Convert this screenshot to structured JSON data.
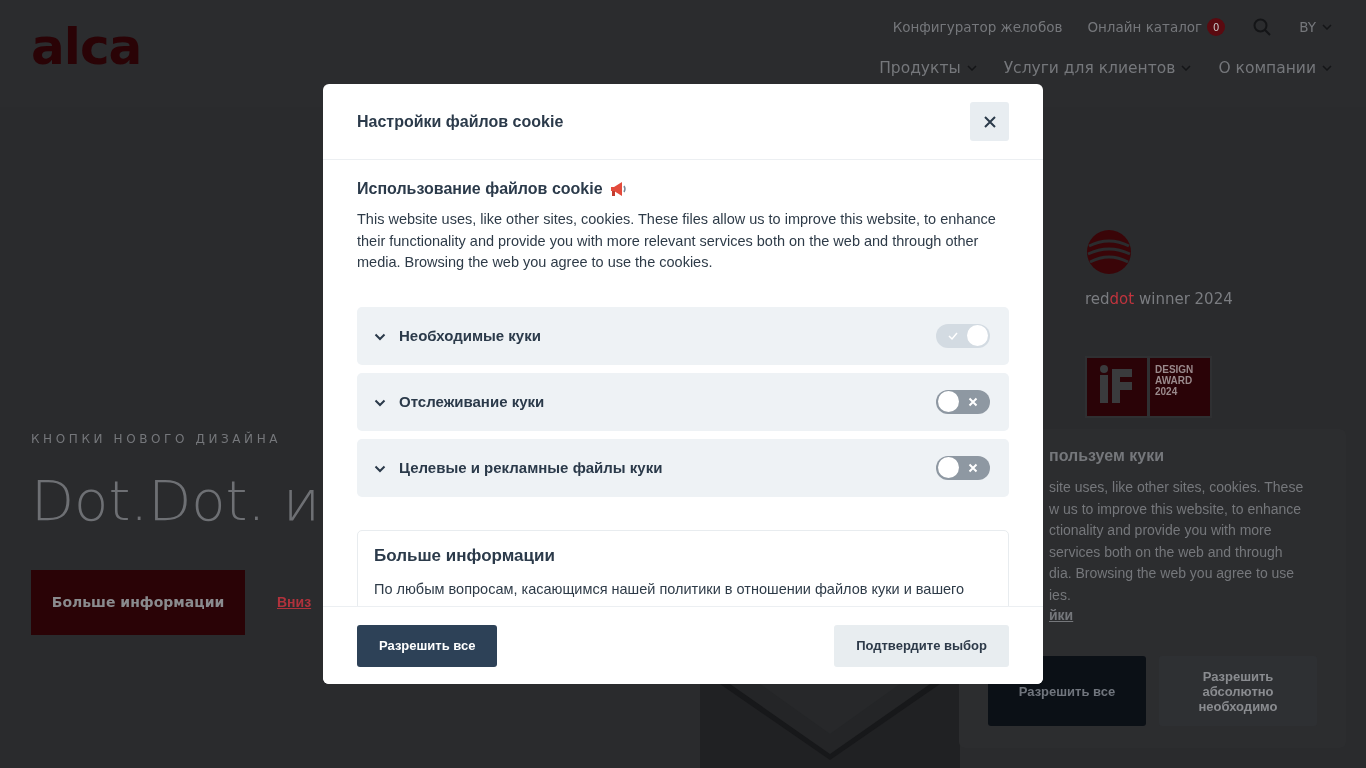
{
  "header": {
    "logo": "alca",
    "top_links": [
      {
        "label": "Конфигуратор желобов"
      },
      {
        "label": "Онлайн каталог",
        "badge": "0"
      }
    ],
    "language": "BY",
    "nav": [
      "Продукты",
      "Услуги для клиентов",
      "О компании"
    ]
  },
  "hero": {
    "eyebrow": "КНОПКИ НОВОГО ДИЗАЙНА",
    "title": "Dot.Dot. и",
    "button": "Больше информации",
    "link": "Вниз"
  },
  "awards": {
    "reddot": {
      "part_a": "red",
      "part_b": "dot",
      "caption": "winner 2024"
    },
    "if_award": [
      "DESIGN",
      "AWARD",
      "2024"
    ]
  },
  "cookie_banner": {
    "title": "пользуем куки",
    "lines": [
      "site uses, like other sites, cookies. These",
      "w us to improve this website, to enhance",
      "ctionality and provide you with more",
      "services both on the web and through",
      "dia. Browsing the web you agree to use",
      "ies."
    ],
    "link": "йки",
    "buttons": [
      {
        "label": "Разрешить все",
        "kind": "primary"
      },
      {
        "label": "Разрешить абсолютно необходимо",
        "kind": "secondary"
      }
    ]
  },
  "modal": {
    "title": "Настройки файлов cookie",
    "intro_title": "Использование файлов cookie",
    "intro_text": "This website uses, like other sites, cookies. These files allow us to improve this website, to enhance their functionality and provide you with more relevant services both on the web and through other media. Browsing the web you agree to use the cookies.",
    "categories": [
      {
        "label": "Необходимые куки",
        "on": true,
        "disabled": true
      },
      {
        "label": "Отслеживание куки",
        "on": false,
        "disabled": false
      },
      {
        "label": "Целевые и рекламные файлы куки",
        "on": false,
        "disabled": false
      }
    ],
    "more_info": {
      "title": "Больше информации",
      "text": "По любым вопросам, касающимся нашей политики в отношении файлов куки и вашего"
    },
    "buttons": [
      {
        "label": "Разрешить все",
        "kind": "primary"
      },
      {
        "label": "Подтвердите выбор",
        "kind": "secondary"
      }
    ]
  }
}
